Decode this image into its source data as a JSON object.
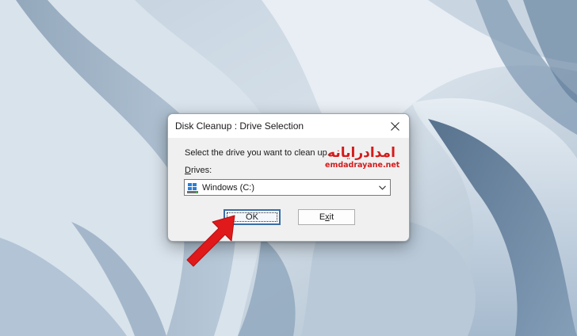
{
  "dialog": {
    "title": "Disk Cleanup : Drive Selection",
    "prompt": "Select the drive you want to clean up.",
    "drives_label_underlined": "D",
    "drives_label_rest": "rives:",
    "selected_drive": "Windows (C:)",
    "ok_label": "OK",
    "exit_label_pre": "E",
    "exit_label_underlined": "x",
    "exit_label_post": "it"
  },
  "watermark": {
    "arabic_text": "امدادرایانه",
    "latin_text": "emdadrayane.net",
    "color": "#d51a1a"
  },
  "annotation": {
    "arrow_color": "#e0191b"
  },
  "icons": {
    "close": "close-icon",
    "drive": "windows-drive-icon",
    "chevron": "chevron-down-icon"
  }
}
